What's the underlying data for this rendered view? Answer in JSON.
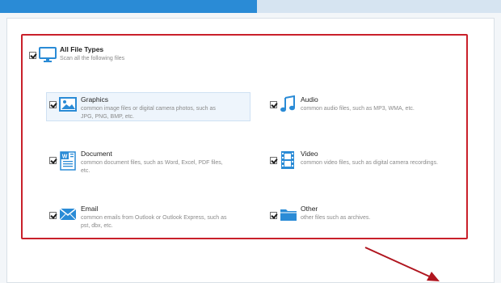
{
  "window": {
    "tabs": [
      {
        "label": ""
      },
      {
        "label": ""
      }
    ]
  },
  "all_types": {
    "title": "All File Types",
    "subtitle": "Scan all the following files",
    "checked": true
  },
  "categories": [
    {
      "title": "Graphics",
      "desc_lines": [
        "common image files or digital camera photos, such as",
        "JPG, PNG, BMP, etc."
      ],
      "checked": true,
      "icon": "image-icon"
    },
    {
      "title": "Audio",
      "desc_lines": [
        "common audio files, such as MP3, WMA, etc."
      ],
      "checked": true,
      "icon": "music-note-icon"
    },
    {
      "title": "Document",
      "desc_lines": [
        "common document files, such as Word, Excel, PDF files,",
        "etc."
      ],
      "checked": true,
      "icon": "word-document-icon"
    },
    {
      "title": "Video",
      "desc_lines": [
        "common video files, such as digital camera recordings."
      ],
      "checked": true,
      "icon": "film-strip-icon"
    },
    {
      "title": "Email",
      "desc_lines": [
        "common emails from Outlook or Outlook Express, such as",
        "pst, dbx, etc."
      ],
      "checked": true,
      "icon": "envelope-icon"
    },
    {
      "title": "Other",
      "desc_lines": [
        "other files such as archives."
      ],
      "checked": true,
      "icon": "folder-icon"
    }
  ],
  "colors": {
    "accent": "#2a8bd6",
    "annotation_red": "#c9202a",
    "icon_blue": "#2a8bd6"
  }
}
